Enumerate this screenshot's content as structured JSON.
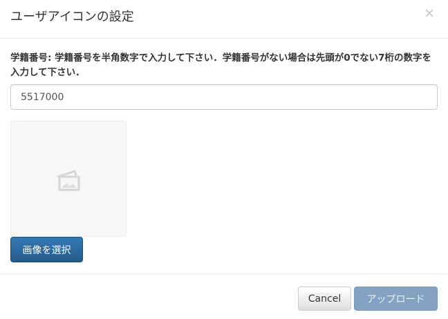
{
  "dialog": {
    "title": "ユーザアイコンの設定",
    "close_icon": "close-icon"
  },
  "form": {
    "label": "学籍番号: 学籍番号を半角数字で入力して下さい．学籍番号がない場合は先頭が0でない7桁の数字を入力して下さい．",
    "value": "5517000"
  },
  "image": {
    "placeholder_icon": "image-placeholder-icon",
    "select_label": "画像を選択"
  },
  "footer": {
    "cancel_label": "Cancel",
    "upload_label": "アップロード"
  },
  "colors": {
    "primary": "#337ab7",
    "primary_disabled": "#7e9fc0"
  }
}
